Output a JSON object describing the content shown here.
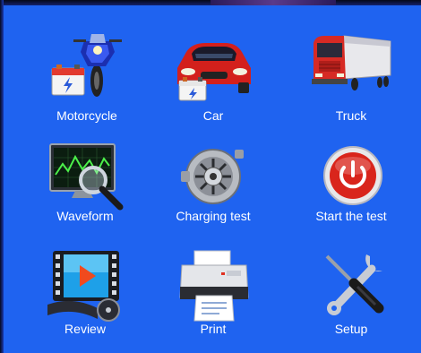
{
  "menu": {
    "items": [
      {
        "label": "Motorcycle",
        "icon": "motorcycle-battery-icon"
      },
      {
        "label": "Car",
        "icon": "car-battery-icon"
      },
      {
        "label": "Truck",
        "icon": "truck-icon"
      },
      {
        "label": "Waveform",
        "icon": "waveform-monitor-icon"
      },
      {
        "label": "Charging test",
        "icon": "alternator-icon"
      },
      {
        "label": "Start the test",
        "icon": "power-icon"
      },
      {
        "label": "Review",
        "icon": "film-play-icon"
      },
      {
        "label": "Print",
        "icon": "printer-icon"
      },
      {
        "label": "Setup",
        "icon": "wrench-screwdriver-icon"
      }
    ]
  },
  "colors": {
    "background": "#1f63f0",
    "label": "#ffffff",
    "power_red": "#d9251c",
    "truck_red": "#d62a24"
  }
}
